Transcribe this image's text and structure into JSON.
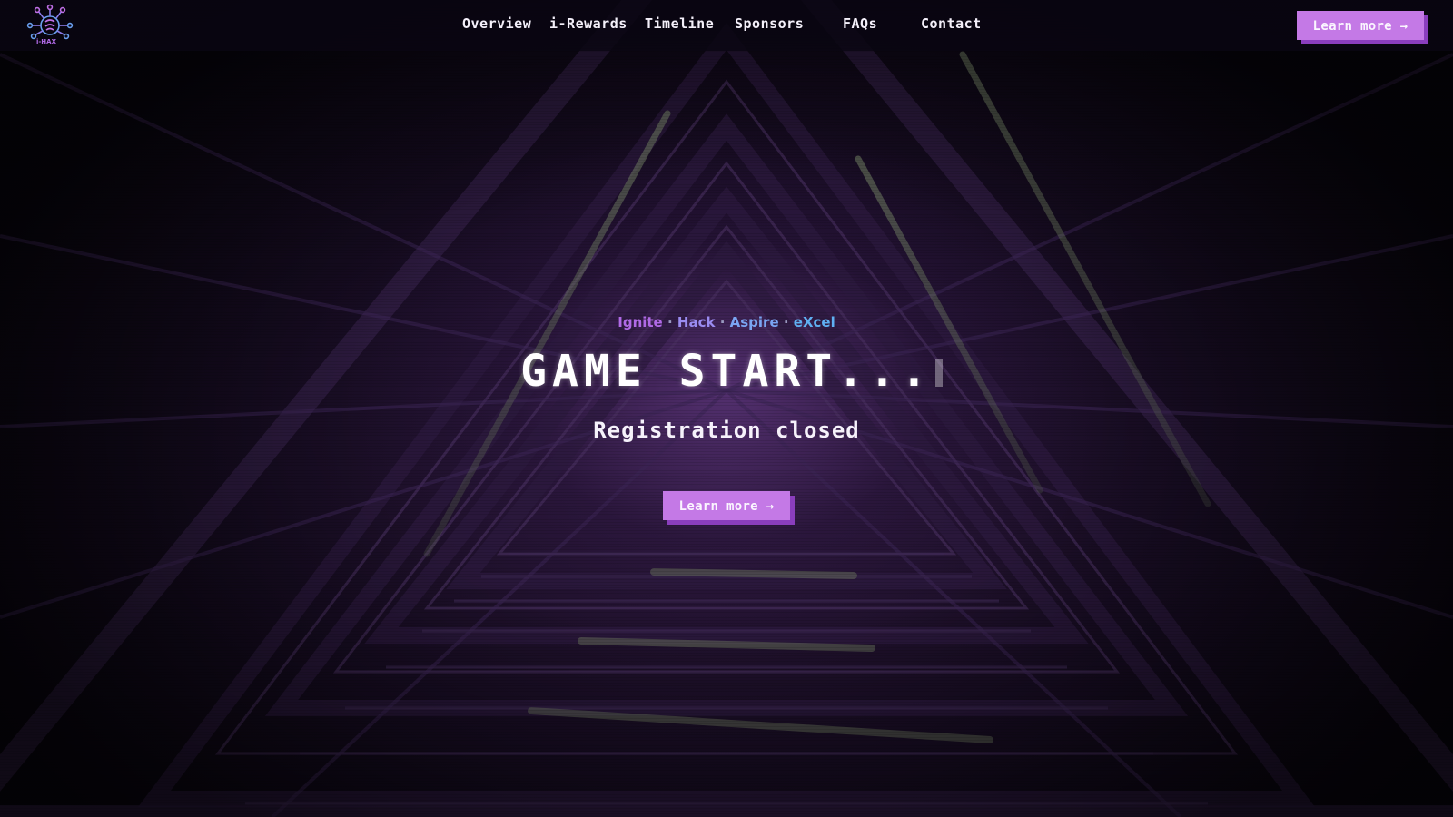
{
  "header": {
    "logo_icon": "i-hax-circuit-brain-logo",
    "logo_text": "i-HAX",
    "nav": [
      {
        "label": "Overview"
      },
      {
        "label": "i-Rewards"
      },
      {
        "label": "Timeline"
      },
      {
        "label": "Sponsors"
      },
      {
        "label": "FAQs"
      },
      {
        "label": "Contact"
      }
    ],
    "cta_label": "Learn more →"
  },
  "hero": {
    "tagline": {
      "w1": "Ignite",
      "w2": "Hack",
      "w3": "Aspire",
      "w4": "eXcel",
      "separator": "·"
    },
    "title": "GAME START...",
    "subtitle": "Registration closed",
    "cta_label": "Learn more →"
  },
  "colors": {
    "accent": "#c479e6",
    "accent_shadow": "#8a3ebd",
    "background": "#07040c",
    "tagline_purple": "#b06ae6",
    "tagline_blue": "#5fb0f2"
  }
}
